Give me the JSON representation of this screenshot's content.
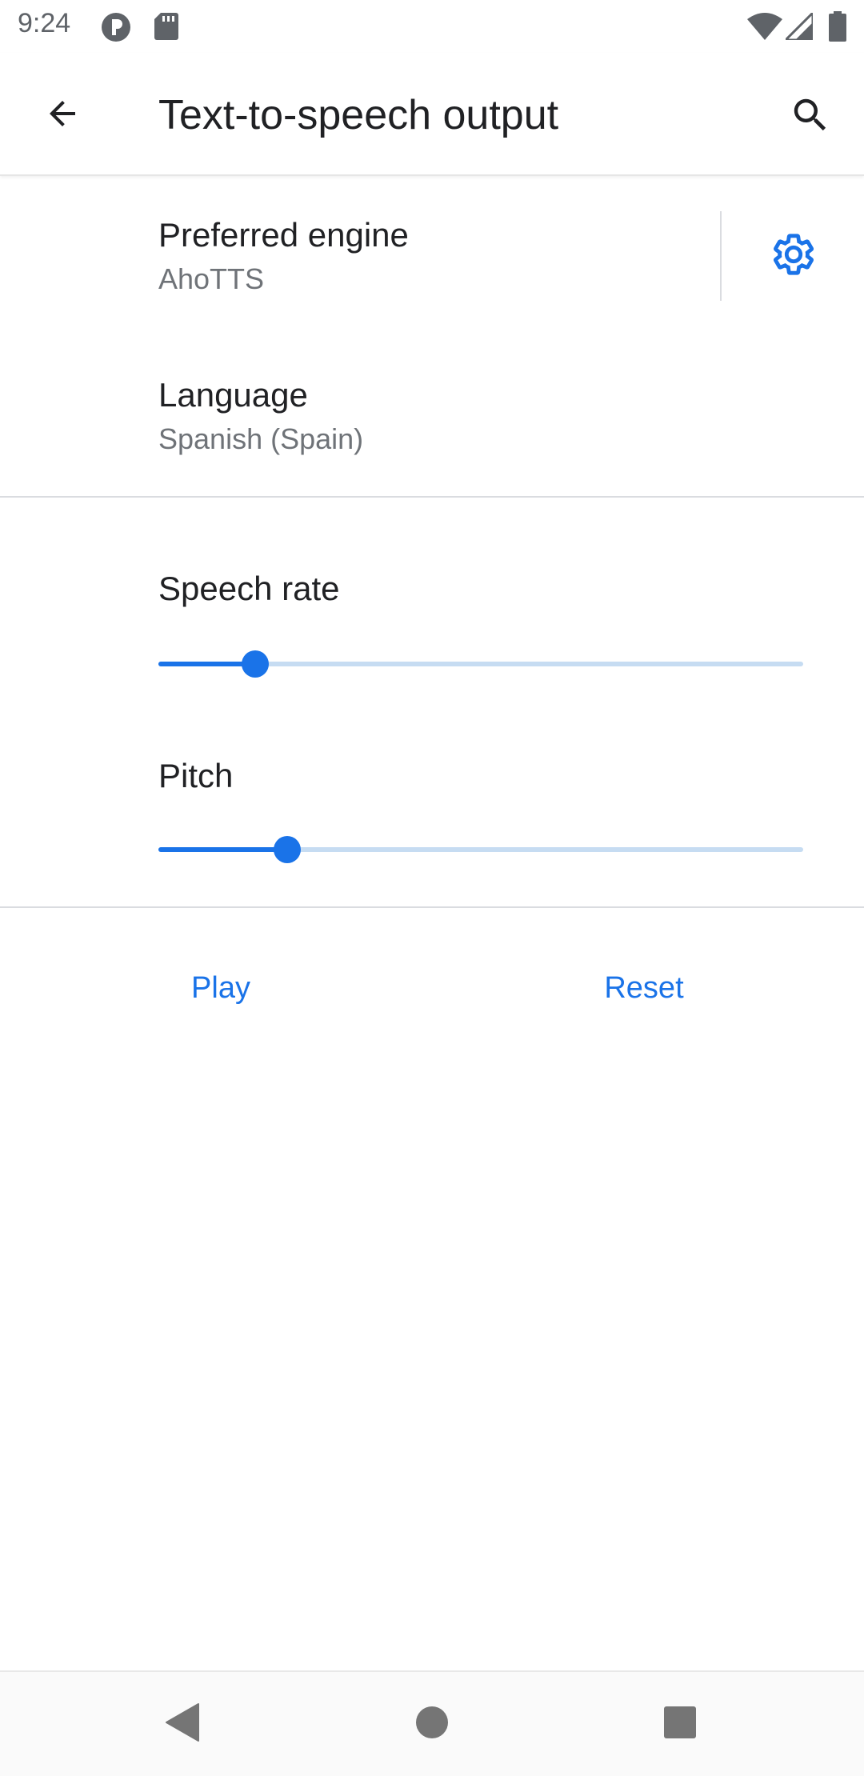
{
  "status_bar": {
    "time": "9:24",
    "icons": [
      "notification-p-icon",
      "sd-card-icon",
      "wifi-icon",
      "cell-signal-icon",
      "battery-icon"
    ]
  },
  "app_bar": {
    "title": "Text-to-speech output",
    "back_icon": "arrow-back-icon",
    "search_icon": "search-icon"
  },
  "preferences": {
    "engine": {
      "title": "Preferred engine",
      "summary": "AhoTTS",
      "settings_icon": "gear-icon"
    },
    "language": {
      "title": "Language",
      "summary": "Spanish (Spain)"
    },
    "speech_rate": {
      "title": "Speech rate",
      "value_fraction": 0.15
    },
    "pitch": {
      "title": "Pitch",
      "value_fraction": 0.2
    }
  },
  "actions": {
    "play_label": "Play",
    "reset_label": "Reset"
  },
  "nav_bar": {
    "icons": [
      "nav-back-icon",
      "nav-home-icon",
      "nav-recents-icon"
    ]
  },
  "colors": {
    "accent": "#1a73e8",
    "track": "#c6dcf2",
    "text_primary": "#202124",
    "text_secondary": "#6f7378"
  }
}
